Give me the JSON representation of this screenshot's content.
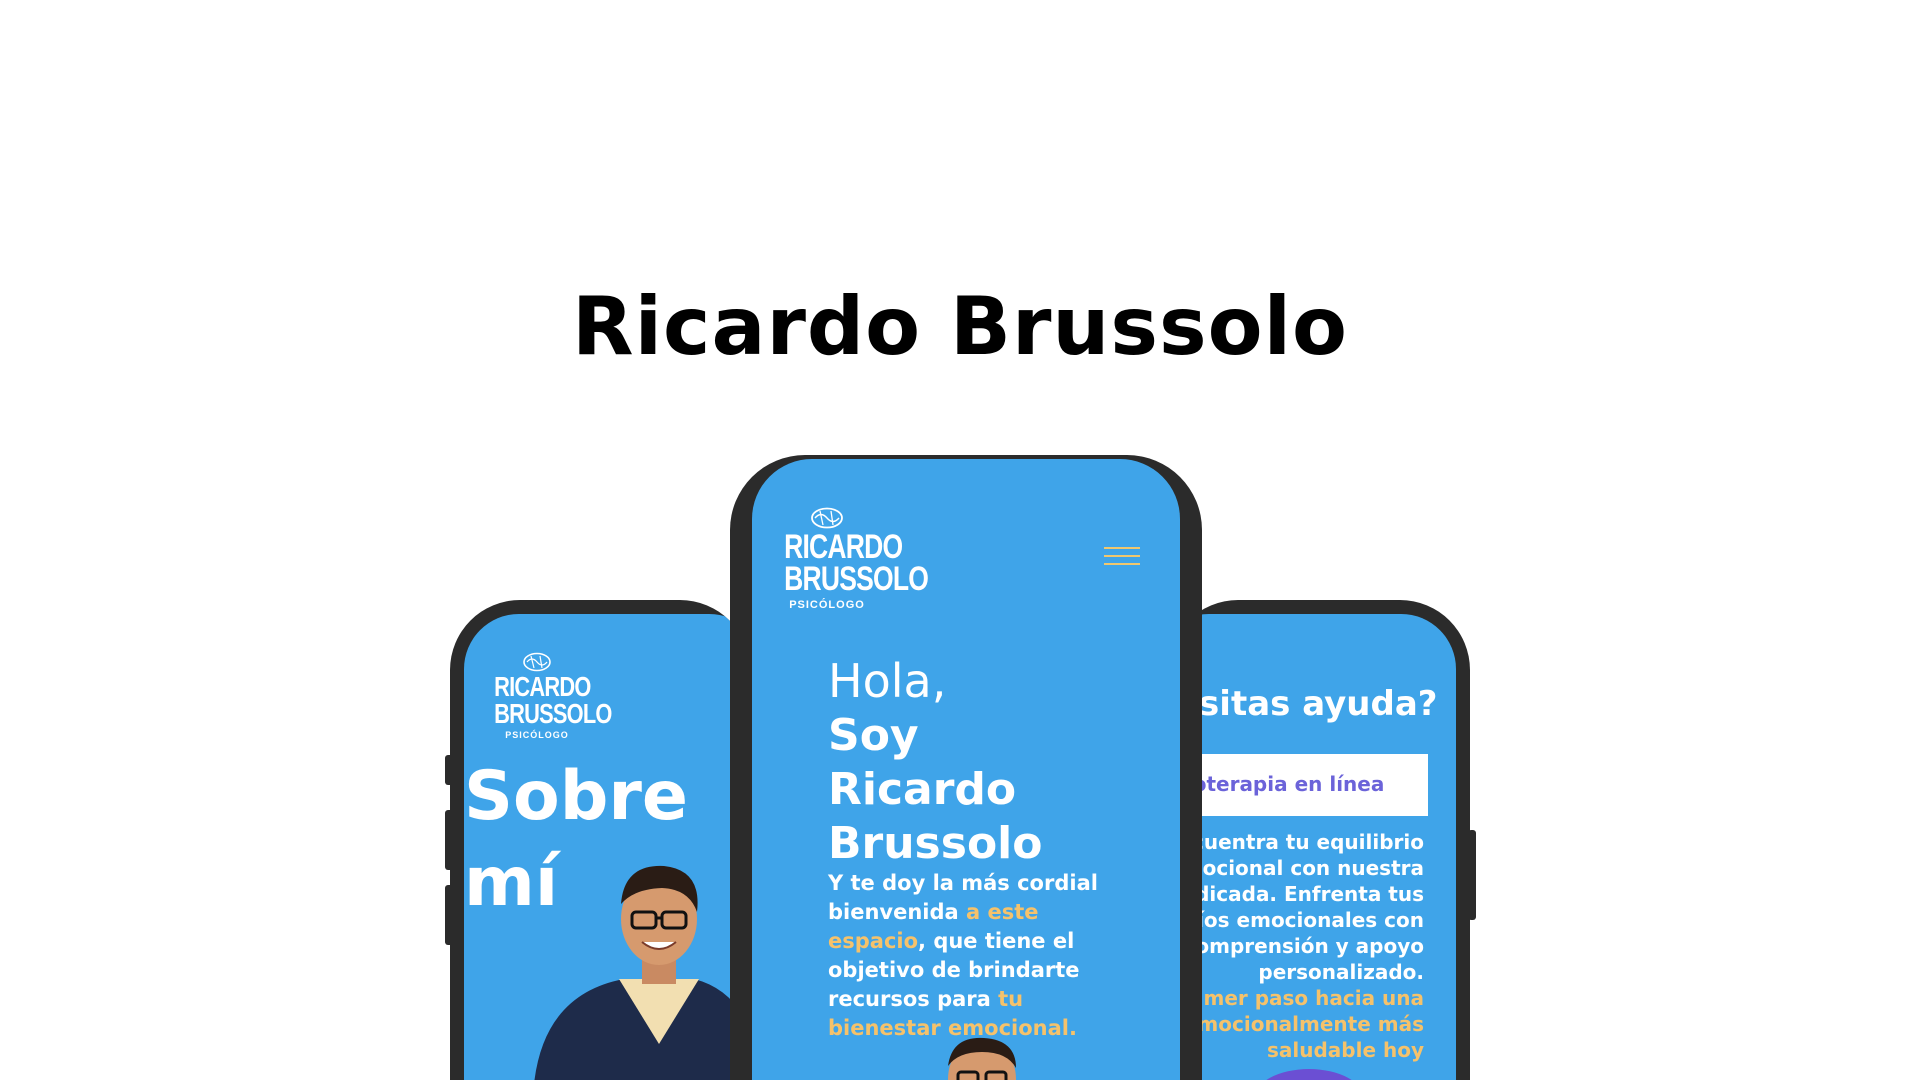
{
  "title": "Ricardo Brussolo",
  "logo": {
    "line1": "RICARDO",
    "line2": "BRUSSOLO",
    "subtitle": "PSICÓLOGO"
  },
  "left_phone": {
    "heading_line1": "Sobre",
    "heading_line2": "mí"
  },
  "center_phone": {
    "greeting": "Hola,",
    "name_line1": "Soy",
    "name_line2": "Ricardo",
    "name_line3": "Brussolo",
    "intro_part1": "Y te doy la más cordial bienvenida",
    "intro_highlight1": "a este espacio",
    "intro_part2": ", que tiene el objetivo de brindarte recursos para",
    "intro_highlight2": "tu bienestar emocional."
  },
  "right_phone": {
    "heading": "esitas ayuda?",
    "service_label": "icoterapia en línea",
    "body_text": "Encuentra tu equilibrio emocional con nuestra dedicada. Enfrenta tus afíos emocionales con comprensión y apoyo personalizado.",
    "highlight_text": "primer paso hacia una emocionalmente más saludable hoy"
  },
  "colors": {
    "screen_bg": "#3fa4e9",
    "accent": "#f5c26b",
    "frame": "#2b2b2b",
    "service_text": "#6b63d9"
  }
}
